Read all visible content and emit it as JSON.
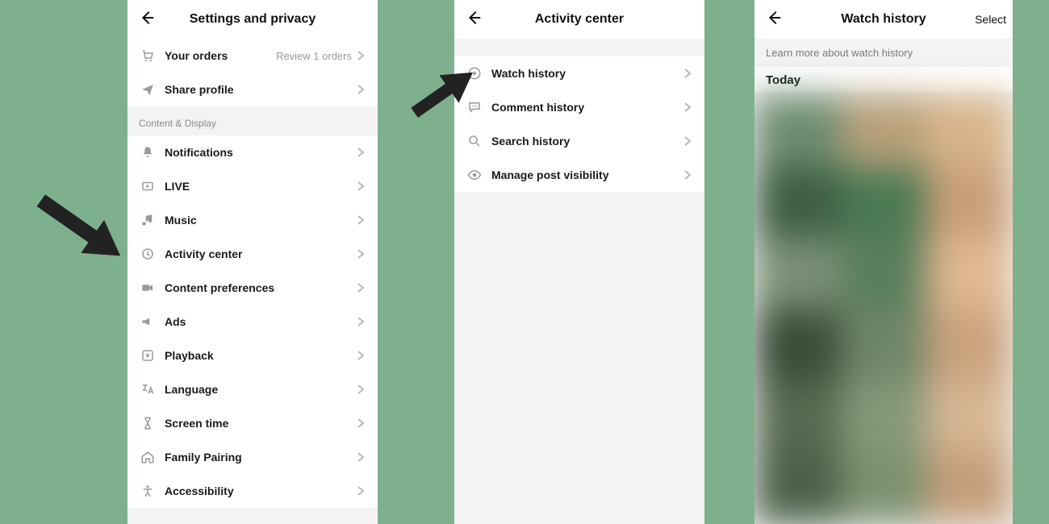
{
  "screen1": {
    "title": "Settings and privacy",
    "orders": {
      "label": "Your orders",
      "value": "Review 1 orders"
    },
    "share": {
      "label": "Share profile"
    },
    "section": "Content & Display",
    "items": [
      {
        "label": "Notifications"
      },
      {
        "label": "LIVE"
      },
      {
        "label": "Music"
      },
      {
        "label": "Activity center"
      },
      {
        "label": "Content preferences"
      },
      {
        "label": "Ads"
      },
      {
        "label": "Playback"
      },
      {
        "label": "Language"
      },
      {
        "label": "Screen time"
      },
      {
        "label": "Family Pairing"
      },
      {
        "label": "Accessibility"
      }
    ]
  },
  "screen2": {
    "title": "Activity center",
    "items": [
      {
        "label": "Watch history"
      },
      {
        "label": "Comment history"
      },
      {
        "label": "Search history"
      },
      {
        "label": "Manage post visibility"
      }
    ]
  },
  "screen3": {
    "title": "Watch history",
    "select": "Select",
    "info": "Learn more about watch history",
    "today": "Today"
  }
}
